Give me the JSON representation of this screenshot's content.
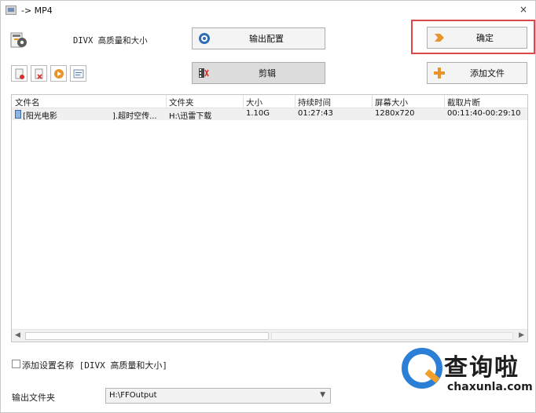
{
  "window": {
    "title": "-> MP4",
    "close_glyph": "×"
  },
  "profile": {
    "label": "DIVX 高质量和大小"
  },
  "buttons": {
    "config_label": "输出配置",
    "ok_label": "确定",
    "clip_label": "剪辑",
    "add_file_label": "添加文件"
  },
  "icons": {
    "profile": "divx-profile-icon",
    "config": "settings-globe-icon",
    "ok": "arrow-right-icon",
    "clip": "film-clip-icon",
    "add_file": "plus-icon",
    "small_toolbar": [
      "remove-icon",
      "clear-icon",
      "play-icon",
      "info-icon"
    ]
  },
  "highlight_color": "#e04848",
  "file_list": {
    "columns": [
      "文件名",
      "文件夹",
      "大小",
      "持续时间",
      "屏幕大小",
      "截取片断"
    ],
    "rows": [
      {
        "name": "[阳光电影",
        "name_suffix": "].超时空传...",
        "folder": "H:\\迅雷下载",
        "size": "1.10G",
        "duration": "01:27:43",
        "screen_size": "1280x720",
        "clip": "00:11:40-00:29:10"
      }
    ]
  },
  "add_profile_name": {
    "label": "添加设置名称 [DIVX 高质量和大小]",
    "checked": false
  },
  "output": {
    "label": "输出文件夹",
    "folder_value": "H:\\FFOutput"
  },
  "watermark": {
    "title": "查询啦",
    "url": "chaxunla.com"
  }
}
